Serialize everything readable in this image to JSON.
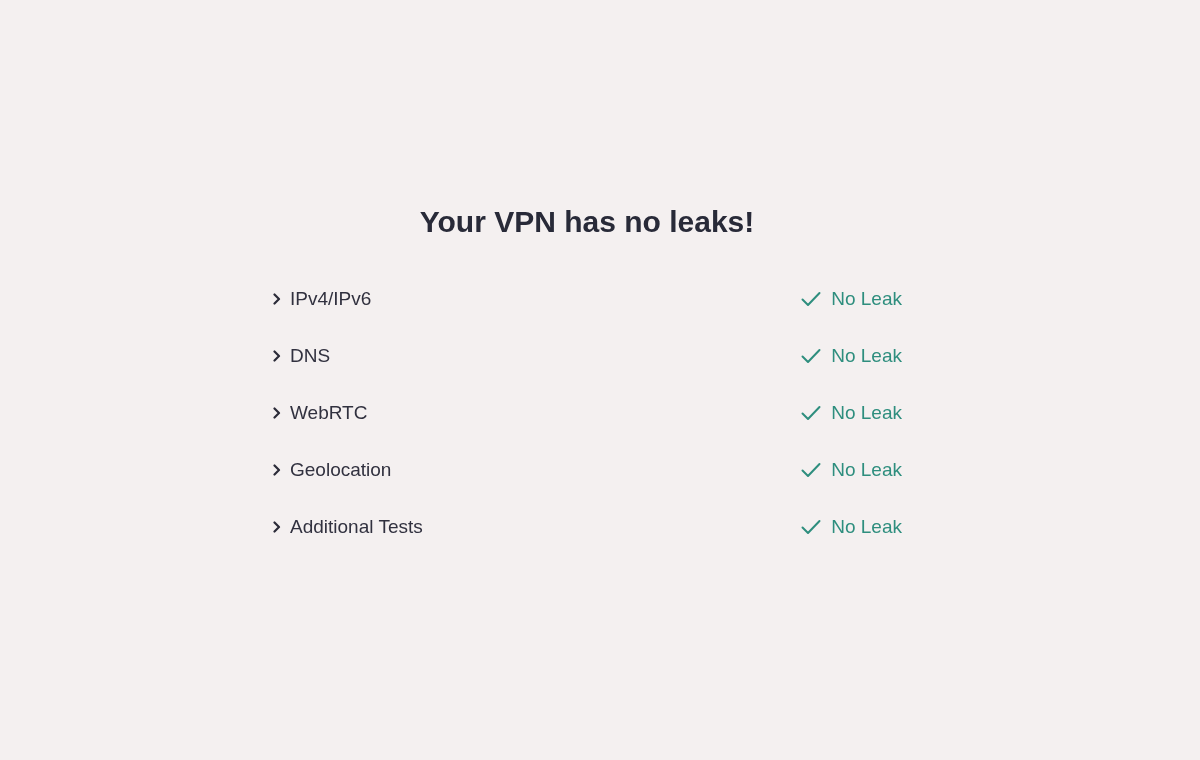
{
  "title": "Your VPN has no leaks!",
  "tests": [
    {
      "label": "IPv4/IPv6",
      "expanded": false,
      "passed": true,
      "result": "No Leak"
    },
    {
      "label": "DNS",
      "expanded": false,
      "passed": true,
      "result": "No Leak"
    },
    {
      "label": "WebRTC",
      "expanded": false,
      "passed": true,
      "result": "No Leak"
    },
    {
      "label": "Geolocation",
      "expanded": false,
      "passed": true,
      "result": "No Leak"
    },
    {
      "label": "Additional Tests",
      "expanded": false,
      "passed": true,
      "result": "No Leak"
    }
  ]
}
